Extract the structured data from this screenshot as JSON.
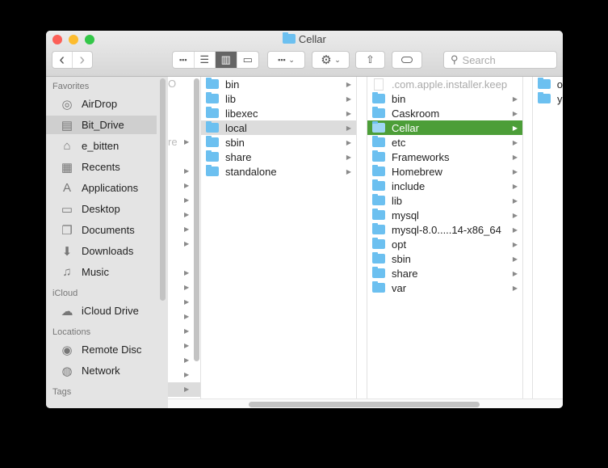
{
  "window": {
    "title": "Cellar",
    "traffic_colors": [
      "#fc5f57",
      "#fdbc2e",
      "#33c748"
    ]
  },
  "toolbar": {
    "back": "‹",
    "forward": "›",
    "search_placeholder": "Search",
    "view_modes": [
      "icon",
      "list",
      "column",
      "gallery"
    ],
    "active_view": "column"
  },
  "sidebar": {
    "sections": [
      {
        "label": "Favorites",
        "items": [
          {
            "label": "AirDrop",
            "icon": "airdrop-icon"
          },
          {
            "label": "Bit_Drive",
            "icon": "drive-icon",
            "selected": true
          },
          {
            "label": "e_bitten",
            "icon": "home-icon"
          },
          {
            "label": "Recents",
            "icon": "recents-icon"
          },
          {
            "label": "Applications",
            "icon": "applications-icon"
          },
          {
            "label": "Desktop",
            "icon": "desktop-icon"
          },
          {
            "label": "Documents",
            "icon": "documents-icon"
          },
          {
            "label": "Downloads",
            "icon": "downloads-icon"
          },
          {
            "label": "Music",
            "icon": "music-icon"
          }
        ]
      },
      {
        "label": "iCloud",
        "items": [
          {
            "label": "iCloud Drive",
            "icon": "cloud-icon"
          }
        ]
      },
      {
        "label": "Locations",
        "items": [
          {
            "label": "Remote Disc",
            "icon": "disc-icon"
          },
          {
            "label": "Network",
            "icon": "network-icon"
          }
        ]
      },
      {
        "label": "Tags",
        "items": []
      }
    ]
  },
  "columns": {
    "col1": {
      "partial_texts": [
        "O",
        "re"
      ]
    },
    "col2": [
      {
        "name": "bin"
      },
      {
        "name": "lib"
      },
      {
        "name": "libexec"
      },
      {
        "name": "local",
        "selected": true
      },
      {
        "name": "sbin"
      },
      {
        "name": "share"
      },
      {
        "name": "standalone"
      }
    ],
    "col3": [
      {
        "name": ".com.apple.installer.keep",
        "file": true
      },
      {
        "name": "bin"
      },
      {
        "name": "Caskroom"
      },
      {
        "name": "Cellar",
        "active": true
      },
      {
        "name": "etc"
      },
      {
        "name": "Frameworks"
      },
      {
        "name": "Homebrew"
      },
      {
        "name": "include"
      },
      {
        "name": "lib"
      },
      {
        "name": "mysql",
        "alias": true
      },
      {
        "name": "mysql-8.0.....14-x86_64"
      },
      {
        "name": "opt"
      },
      {
        "name": "sbin"
      },
      {
        "name": "share"
      },
      {
        "name": "var"
      }
    ],
    "col4": [
      {
        "name": "o"
      },
      {
        "name": "y"
      }
    ]
  },
  "colors": {
    "selection_active": "#4c9e38",
    "folder": "#6cc0f0"
  }
}
